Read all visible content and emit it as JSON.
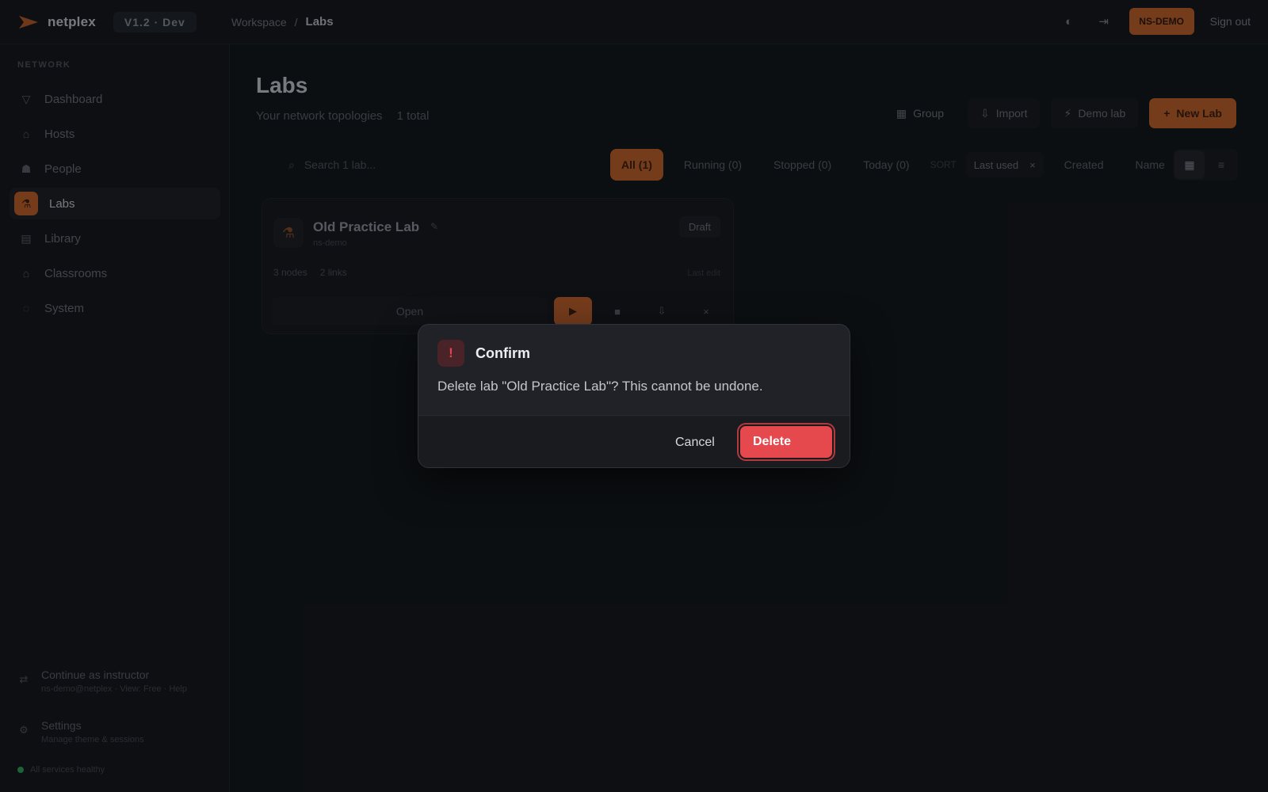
{
  "topbar": {
    "brand": "netplex",
    "version": "V1.2 · Dev",
    "breadcrumb": [
      "Workspace",
      "/",
      "Labs"
    ],
    "user_badge": "NS-DEMO",
    "signout": "Sign out",
    "icons": [
      "moon-icon",
      "collapse-icon"
    ]
  },
  "sidebar": {
    "section_label": "NETWORK",
    "items": [
      {
        "label": "Dashboard",
        "icon": "dashboard-icon"
      },
      {
        "label": "Hosts",
        "icon": "home-icon"
      },
      {
        "label": "People",
        "icon": "people-icon"
      },
      {
        "label": "Labs",
        "icon": "lab-icon",
        "active": true
      },
      {
        "label": "Library",
        "icon": "library-icon"
      },
      {
        "label": "Classrooms",
        "icon": "classroom-icon"
      },
      {
        "label": "System",
        "icon": "system-icon"
      }
    ],
    "footer1": {
      "title": "Continue as instructor",
      "sub": "ns-demo@netplex · View: Free · Help"
    },
    "footer2": {
      "title": "Settings",
      "sub": "Manage theme & sessions"
    },
    "status": "All services healthy"
  },
  "main": {
    "title": "Labs",
    "subtitle": "Your network topologies",
    "count": "1 total",
    "actions": {
      "group": "Group",
      "import": "Import",
      "demo": "Demo lab",
      "new": "New Lab"
    },
    "search_placeholder": "Search 1 lab...",
    "filters": [
      {
        "label": "All (1)",
        "active": true
      },
      {
        "label": "Running (0)"
      },
      {
        "label": "Stopped (0)"
      },
      {
        "label": "Today (0)"
      }
    ],
    "sort_label": "SORT",
    "sort_options": {
      "selected": "Last used",
      "others": [
        "Created",
        "Name"
      ]
    },
    "lab": {
      "name": "Old Practice Lab",
      "owner": "ns-demo",
      "status": "Draft",
      "nodes": "3 nodes",
      "links": "2 links",
      "date": "Last edit",
      "open": "Open"
    }
  },
  "modal": {
    "title": "Confirm",
    "message": "Delete lab \"Old Practice Lab\"? This cannot be undone.",
    "cancel": "Cancel",
    "delete": "Delete",
    "accent_color": "#e5484d",
    "warn_glyph": "!"
  }
}
